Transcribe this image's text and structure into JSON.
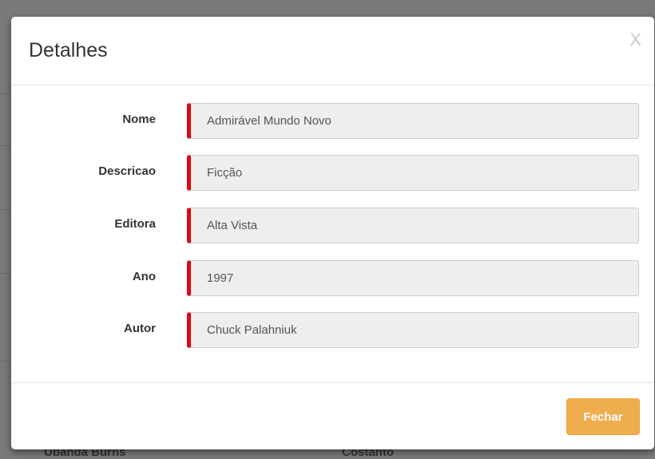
{
  "backdrop": {
    "row_left_text": "Ubanda Burns",
    "row_mid_text": "Costanto"
  },
  "modal": {
    "title": "Detalhes",
    "close_icon_text": "X",
    "fields": [
      {
        "label": "Nome",
        "value": "Admirável Mundo Novo"
      },
      {
        "label": "Descricao",
        "value": "Ficção"
      },
      {
        "label": "Editora",
        "value": "Alta Vista"
      },
      {
        "label": "Ano",
        "value": "1997"
      },
      {
        "label": "Autor",
        "value": "Chuck Palahniuk"
      }
    ],
    "footer": {
      "close_button_label": "Fechar"
    }
  },
  "colors": {
    "required_indicator": "#e0070f",
    "button_warning": "#f0ad4e",
    "input_background": "#eeeeee"
  }
}
